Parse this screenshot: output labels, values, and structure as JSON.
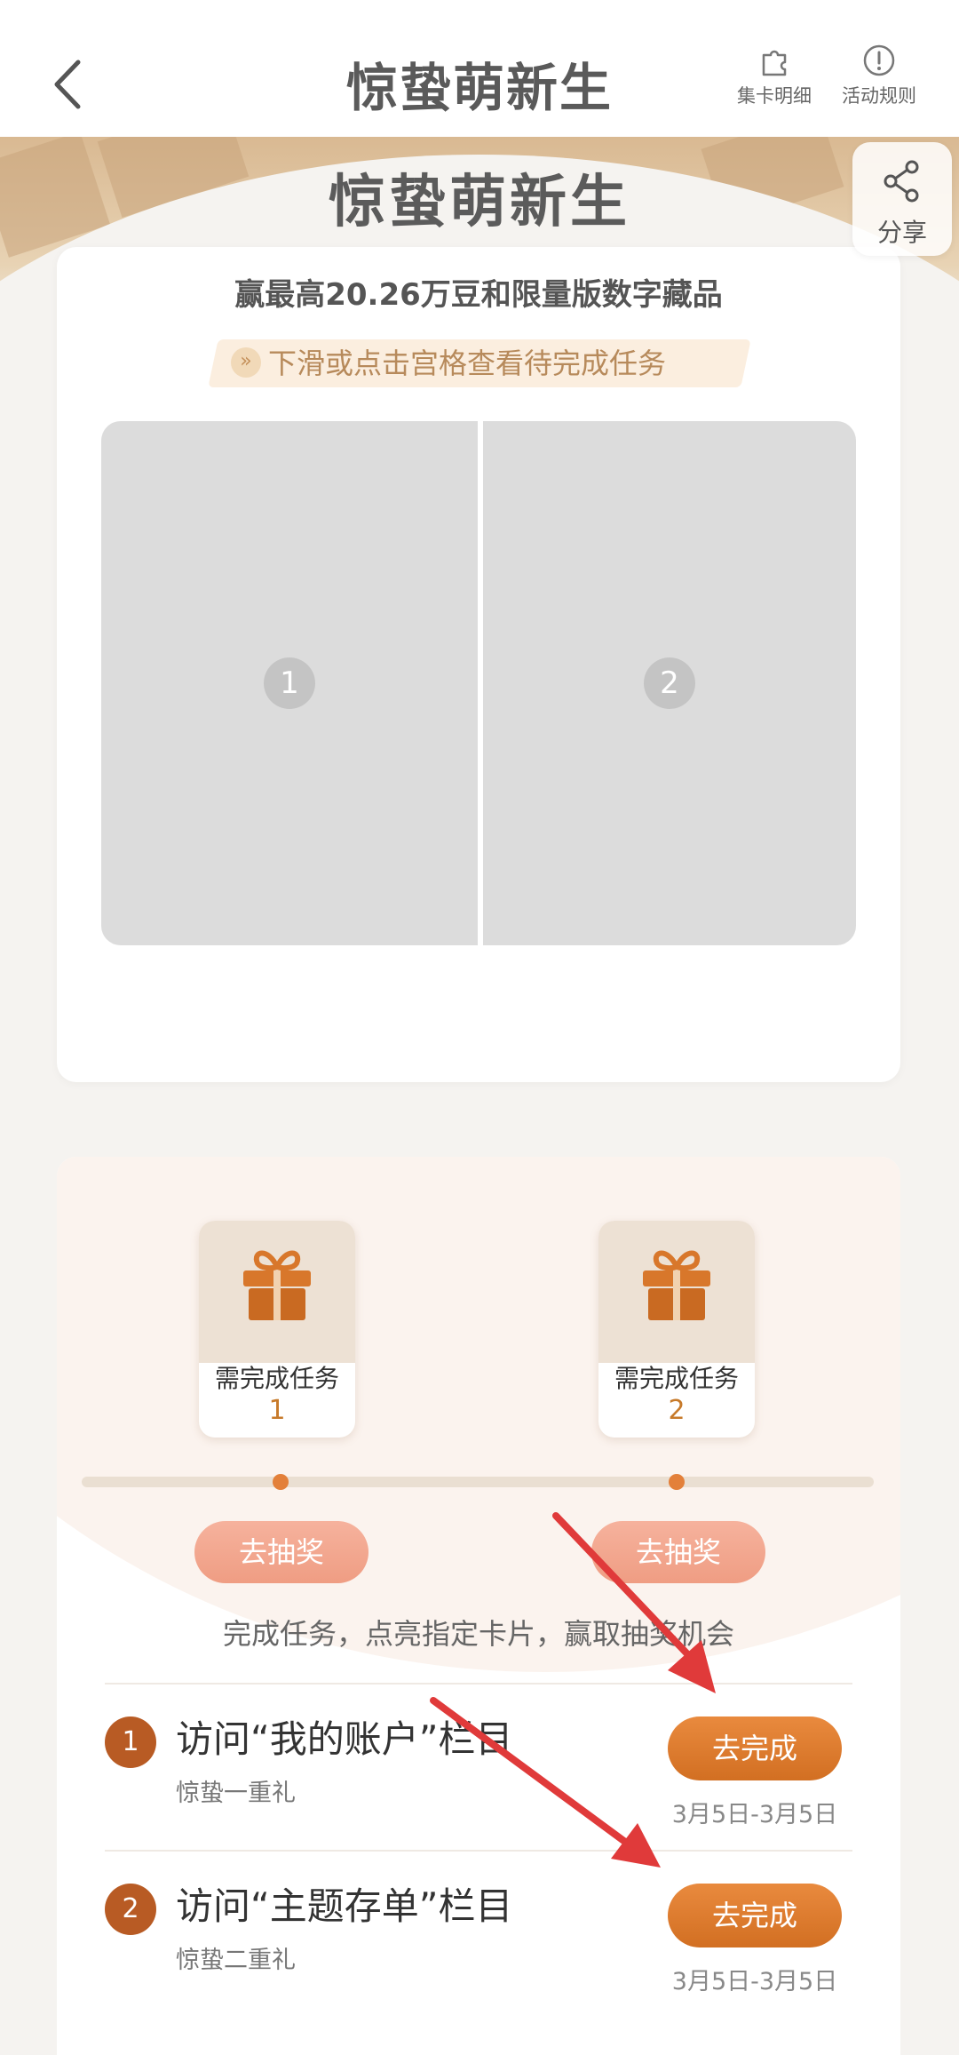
{
  "nav": {
    "title": "惊蛰萌新生",
    "card_detail": "集卡明细",
    "rules": "活动规则"
  },
  "hero": {
    "title": "惊蛰萌新生",
    "share": "分享"
  },
  "card": {
    "subtitle": "赢最高20.26万豆和限量版数字藏品",
    "hint": "下滑或点击宫格查看待完成任务",
    "cells": [
      "1",
      "2"
    ]
  },
  "rewards": [
    {
      "need": "需完成任务",
      "count": "1",
      "button": "去抽奖"
    },
    {
      "need": "需完成任务",
      "count": "2",
      "button": "去抽奖"
    }
  ],
  "description": "完成任务，点亮指定卡片，赢取抽奖机会",
  "tasks": [
    {
      "num": "1",
      "title": "访问“我的账户”栏目",
      "sub": "惊蛰一重礼",
      "button": "去完成",
      "date": "3月5日-3月5日"
    },
    {
      "num": "2",
      "title": "访问“主题存单”栏目",
      "sub": "惊蛰二重礼",
      "button": "去完成",
      "date": "3月5日-3月5日"
    }
  ],
  "colors": {
    "accent": "#d26f22",
    "badge": "#b85b24",
    "annotation_arrow": "#e03a3a"
  }
}
